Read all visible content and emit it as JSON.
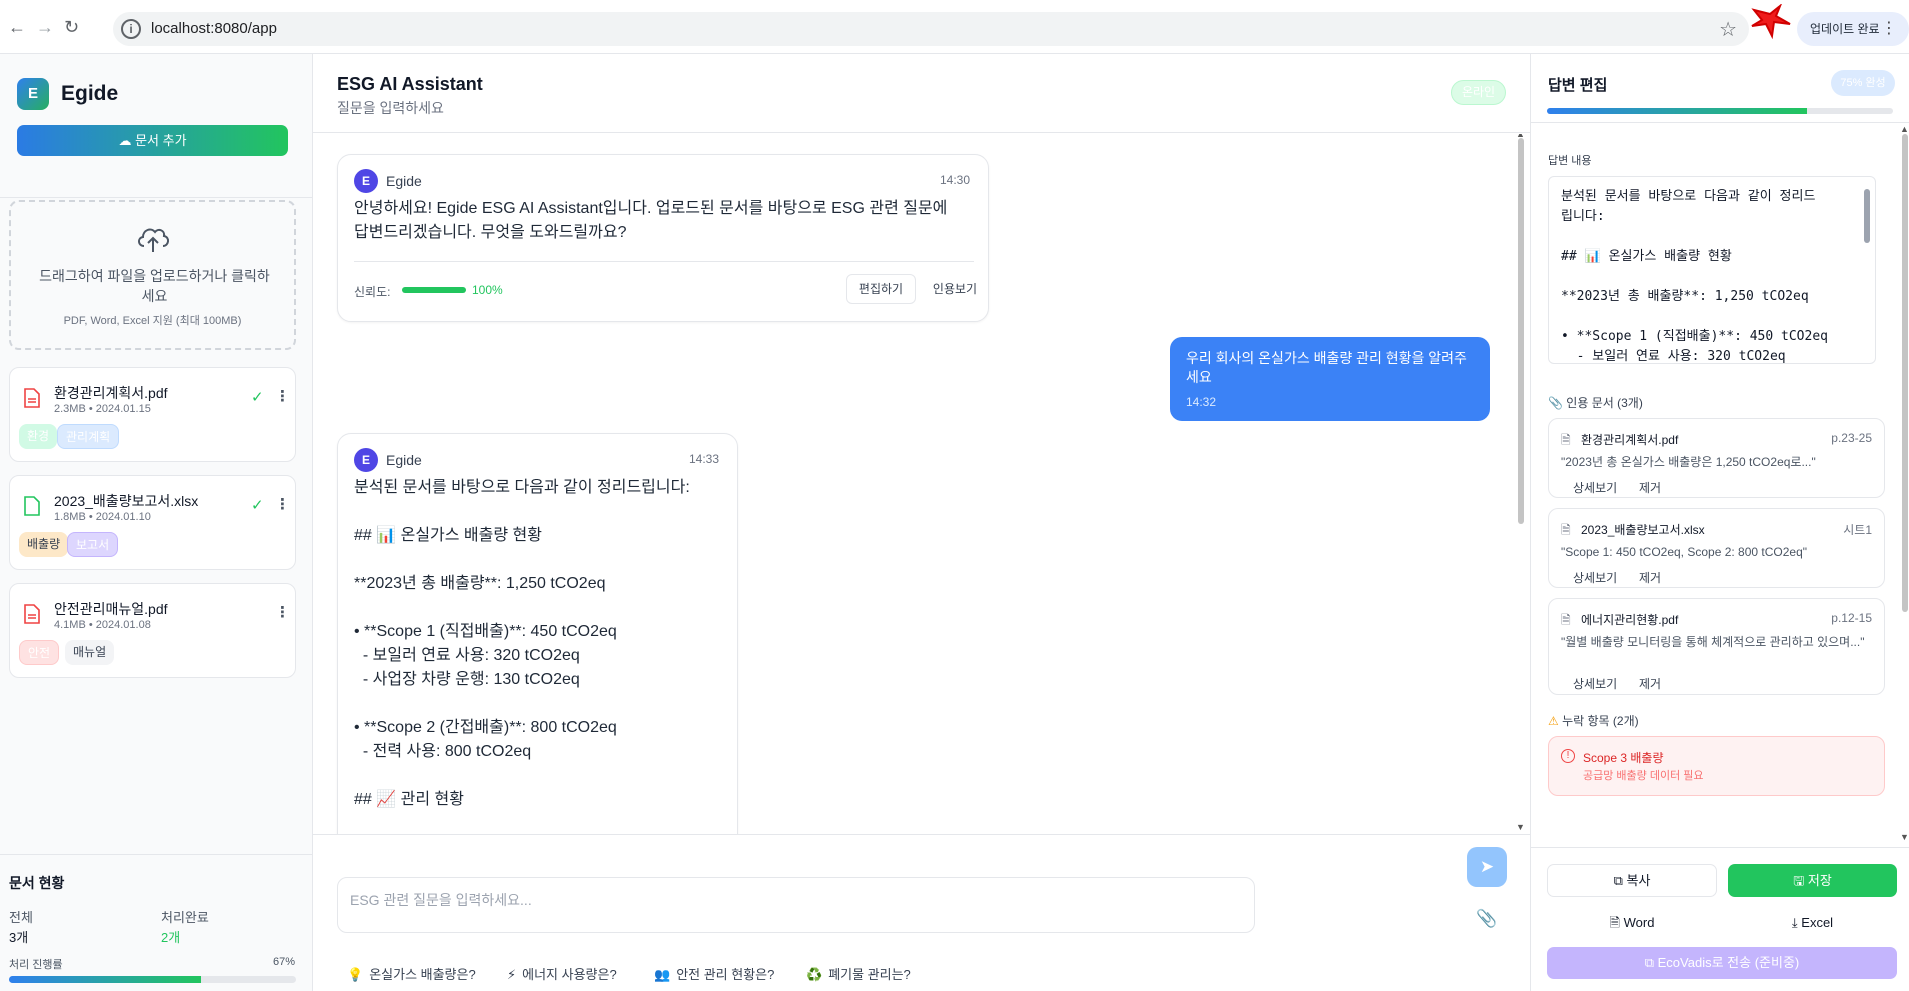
{
  "browser": {
    "url": "localhost:8080/app",
    "update_label": "업데이트 완료"
  },
  "sidebar": {
    "logo_letter": "E",
    "app_name": "Egide",
    "add_button": "문서 추가",
    "dropzone": {
      "main_text": "드래그하여 파일을 업로드하거나 클릭하세요",
      "sub_text": "PDF, Word, Excel 지원 (최대 100MB)"
    },
    "files": [
      {
        "name": "환경관리계획서.pdf",
        "meta": "2.3MB • 2024.01.15",
        "tags": [
          "환경",
          "관리계획"
        ],
        "processed": true,
        "icon": "pdf-icon",
        "color": "#ef4444"
      },
      {
        "name": "2023_배출량보고서.xlsx",
        "meta": "1.8MB • 2024.01.10",
        "tags": [
          "배출량",
          "보고서"
        ],
        "processed": true,
        "icon": "excel-icon",
        "color": "#22c55e"
      },
      {
        "name": "안전관리매뉴얼.pdf",
        "meta": "4.1MB • 2024.01.08",
        "tags": [
          "안전",
          "매뉴얼"
        ],
        "processed": false,
        "icon": "pdf-icon",
        "color": "#ef4444"
      }
    ],
    "stats": {
      "title": "문서 현황",
      "total_label": "전체",
      "total_value": "3개",
      "done_label": "처리완료",
      "done_value": "2개",
      "progress_label": "처리 진행률",
      "progress_value": "67%",
      "progress_fraction": 0.67
    }
  },
  "chat": {
    "title": "ESG AI Assistant",
    "subtitle": "질문을 입력하세요",
    "status": "온라인",
    "messages": [
      {
        "role": "bot",
        "sender": "Egide",
        "time": "14:30",
        "text_lines": [
          "안녕하세요! Egide ESG AI Assistant입니다. 업로드된 문서를 바탕으로 ESG 관련 질문에",
          "답변드리겠습니다. 무엇을 도와드릴까요?"
        ],
        "confidence_label": "신뢰도:",
        "confidence_value": "100%",
        "confidence_fraction": 1.0,
        "edit_label": "편집하기",
        "cite_label": "인용보기"
      },
      {
        "role": "user",
        "text": "우리 회사의 온실가스 배출량 관리 현황을 알려주세요",
        "time": "14:32"
      },
      {
        "role": "bot",
        "sender": "Egide",
        "time": "14:33",
        "text_lines": [
          "분석된 문서를 바탕으로 다음과 같이 정리드립니다:",
          "",
          "## 📊 온실가스 배출량 현황",
          "",
          "**2023년 총 배출량**: 1,250 tCO2eq",
          "",
          "• **Scope 1 (직접배출)**: 450 tCO2eq",
          "  - 보일러 연료 사용: 320 tCO2eq",
          "  - 사업장 차량 운행: 130 tCO2eq",
          "",
          "• **Scope 2 (간접배출)**: 800 tCO2eq",
          "  - 전력 사용: 800 tCO2eq",
          "",
          "## 📈 관리 현황"
        ]
      }
    ],
    "input_placeholder": "ESG 관련 질문을 입력하세요...",
    "suggestions": [
      {
        "icon": "💡",
        "label": "온실가스 배출량은?"
      },
      {
        "icon": "⚡",
        "label": "에너지 사용량은?"
      },
      {
        "icon": "👥",
        "label": "안전 관리 현황은?"
      },
      {
        "icon": "♻️",
        "label": "폐기물 관리는?"
      }
    ]
  },
  "editor": {
    "title": "답변 편집",
    "completion_label": "75% 완성",
    "completion_fraction": 0.75,
    "content_label": "답변 내용",
    "content_lines": [
      "분석된 문서를 바탕으로 다음과 같이 정리드",
      "립니다:",
      "",
      "## 📊 온실가스 배출량 현황",
      "",
      "**2023년 총 배출량**: 1,250 tCO2eq",
      "",
      "• **Scope 1 (직접배출)**: 450 tCO2eq",
      "  - 보일러 연료 사용: 320 tCO2eq"
    ],
    "citations_label": "인용 문서 (3개)",
    "citations": [
      {
        "name": "환경관리계획서.pdf",
        "page": "p.23-25",
        "quote": "\"2023년 총 온실가스 배출량은 1,250 tCO2eq로...\"",
        "detail": "상세보기",
        "remove": "제거"
      },
      {
        "name": "2023_배출량보고서.xlsx",
        "page": "시트1",
        "quote": "\"Scope 1: 450 tCO2eq, Scope 2: 800 tCO2eq\"",
        "detail": "상세보기",
        "remove": "제거"
      },
      {
        "name": "에너지관리현황.pdf",
        "page": "p.12-15",
        "quote": "\"월별 배출량 모니터링을 통해 체계적으로 관리하고 있으며...\"",
        "detail": "상세보기",
        "remove": "제거"
      }
    ],
    "missing_label": "누락 항목 (2개)",
    "missing_items": [
      {
        "title": "Scope 3 배출량",
        "desc": "공급망 배출량 데이터 필요"
      }
    ],
    "buttons": {
      "copy": "복사",
      "save": "저장",
      "word": "Word",
      "excel": "Excel",
      "ecovadis": "EcoVadis로 전송 (준비중)"
    }
  }
}
